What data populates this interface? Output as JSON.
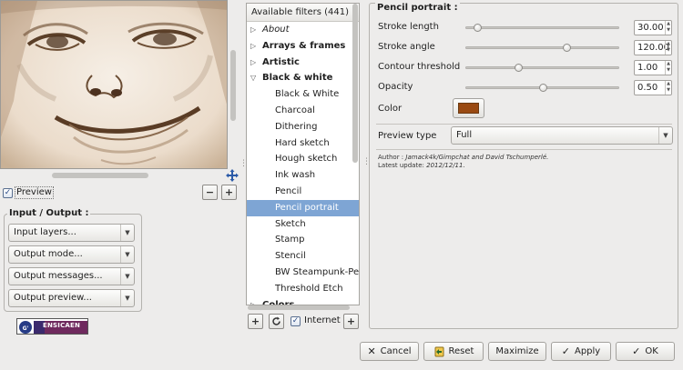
{
  "preview": {
    "checkbox_label": "Preview",
    "checked": true
  },
  "io_group": {
    "title": "Input / Output :",
    "combos": [
      {
        "value": "Input layers..."
      },
      {
        "value": "Output mode..."
      },
      {
        "value": "Output messages..."
      },
      {
        "value": "Output preview..."
      }
    ]
  },
  "logo_text": "ENSICAEN",
  "filters": {
    "header": "Available filters (441) :",
    "rows": [
      {
        "label": "About",
        "kind": "cat",
        "italic": true,
        "expanded": false
      },
      {
        "label": "Arrays & frames",
        "kind": "cat",
        "expanded": false
      },
      {
        "label": "Artistic",
        "kind": "cat",
        "expanded": false
      },
      {
        "label": "Black & white",
        "kind": "cat",
        "expanded": true
      },
      {
        "label": "Black & White",
        "kind": "child"
      },
      {
        "label": "Charcoal",
        "kind": "child"
      },
      {
        "label": "Dithering",
        "kind": "child"
      },
      {
        "label": "Hard sketch",
        "kind": "child"
      },
      {
        "label": "Hough sketch",
        "kind": "child"
      },
      {
        "label": "Ink wash",
        "kind": "child"
      },
      {
        "label": "Pencil",
        "kind": "child"
      },
      {
        "label": "Pencil portrait",
        "kind": "child",
        "selected": true
      },
      {
        "label": "Sketch",
        "kind": "child"
      },
      {
        "label": "Stamp",
        "kind": "child"
      },
      {
        "label": "Stencil",
        "kind": "child"
      },
      {
        "label": "BW Steampunk-Pen",
        "kind": "child"
      },
      {
        "label": "Threshold Etch",
        "kind": "child"
      },
      {
        "label": "Colors",
        "kind": "cat",
        "expanded": false
      }
    ],
    "internet_label": "Internet",
    "internet_checked": true
  },
  "params": {
    "title": "Pencil portrait :",
    "sliders": [
      {
        "label": "Stroke length",
        "value": "30.00",
        "fraction": 0.05
      },
      {
        "label": "Stroke angle",
        "value": "120.00",
        "fraction": 0.66
      },
      {
        "label": "Contour threshold",
        "value": "1.00",
        "fraction": 0.33
      },
      {
        "label": "Opacity",
        "value": "0.50",
        "fraction": 0.5
      }
    ],
    "color_label": "Color",
    "color_value": "#9a4a12",
    "preview_type_label": "Preview type",
    "preview_type_value": "Full",
    "author_prefix": "Author : ",
    "author": "Jamack4k/Gimpchat and David Tschumperlé.",
    "update_prefix": "Latest update: ",
    "update": "2012/12/11."
  },
  "buttons": {
    "cancel": "Cancel",
    "reset": "Reset",
    "maximize": "Maximize",
    "apply": "Apply",
    "ok": "OK"
  }
}
